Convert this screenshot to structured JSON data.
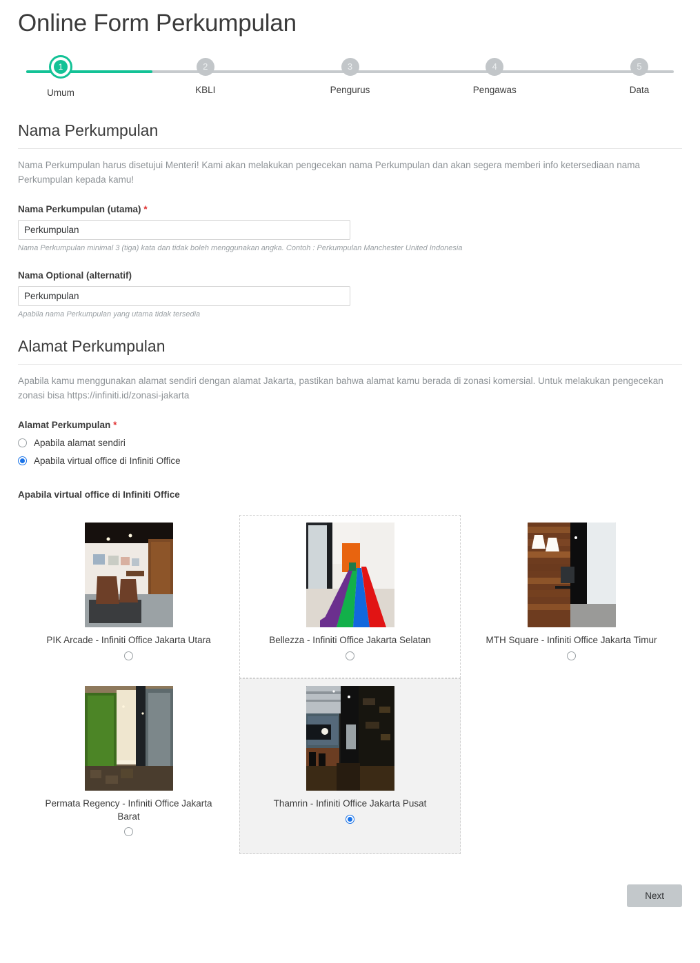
{
  "header": {
    "title": "Online Form Perkumpulan"
  },
  "stepper": {
    "active_index": 0,
    "progress_color": "#13c296",
    "inactive_color": "#c2c6c9",
    "steps": [
      {
        "number": "1",
        "label": "Umum"
      },
      {
        "number": "2",
        "label": "KBLI"
      },
      {
        "number": "3",
        "label": "Pengurus"
      },
      {
        "number": "4",
        "label": "Pengawas"
      },
      {
        "number": "5",
        "label": "Data"
      }
    ]
  },
  "sections": [
    {
      "title": "Nama Perkumpulan",
      "description": "Nama Perkumpulan harus disetujui Menteri! Kami akan melakukan pengecekan nama Perkumpulan dan akan segera memberi info ketersediaan nama Perkumpulan kepada kamu!",
      "fields": [
        {
          "label": "Nama Perkumpulan (utama)",
          "required_mark": "*",
          "value": "Perkumpulan",
          "placeholder": "Perkumpulan",
          "hint": "Nama Perkumpulan minimal 3 (tiga) kata dan tidak boleh menggunakan angka. Contoh : Perkumpulan Manchester United Indonesia"
        },
        {
          "label": "Nama Optional (alternatif)",
          "required_mark": "",
          "value": "Perkumpulan",
          "placeholder": "Perkumpulan",
          "hint": "Apabila nama Perkumpulan yang utama tidak tersedia"
        }
      ]
    },
    {
      "title": "Alamat Perkumpulan",
      "description": "Apabila kamu menggunakan alamat sendiri dengan alamat Jakarta, pastikan bahwa alamat kamu berada di zonasi komersial. Untuk melakukan pengecekan zonasi bisa https://infiniti.id/zonasi-jakarta",
      "address_label": "Alamat Perkumpulan",
      "address_required_mark": "*",
      "address_options": [
        {
          "label": "Apabila alamat sendiri",
          "selected": false
        },
        {
          "label": "Apabila virtual office di Infiniti Office",
          "selected": true
        }
      ],
      "virtual_office_heading": "Apabila virtual office di Infiniti Office",
      "offices": [
        {
          "name": "PIK Arcade - Infiniti Office Jakarta Utara",
          "selected": false,
          "bordered": false,
          "photo": "pik-arcade"
        },
        {
          "name": "Bellezza - Infiniti Office Jakarta Selatan",
          "selected": false,
          "bordered": true,
          "photo": "bellezza"
        },
        {
          "name": "MTH Square - Infiniti Office Jakarta Timur",
          "selected": false,
          "bordered": false,
          "photo": "mth-square"
        },
        {
          "name": "Permata Regency - Infiniti Office Jakarta Barat",
          "selected": false,
          "bordered": false,
          "photo": "permata-regency"
        },
        {
          "name": "Thamrin - Infiniti Office Jakarta Pusat",
          "selected": true,
          "bordered": true,
          "photo": "thamrin"
        }
      ]
    }
  ],
  "footer": {
    "next_label": "Next"
  },
  "colors": {
    "accent_green": "#13c296",
    "radio_blue": "#1a73e8",
    "required_red": "#e03131",
    "muted_text": "#8d9296",
    "button_gray": "#c3c8cb"
  }
}
